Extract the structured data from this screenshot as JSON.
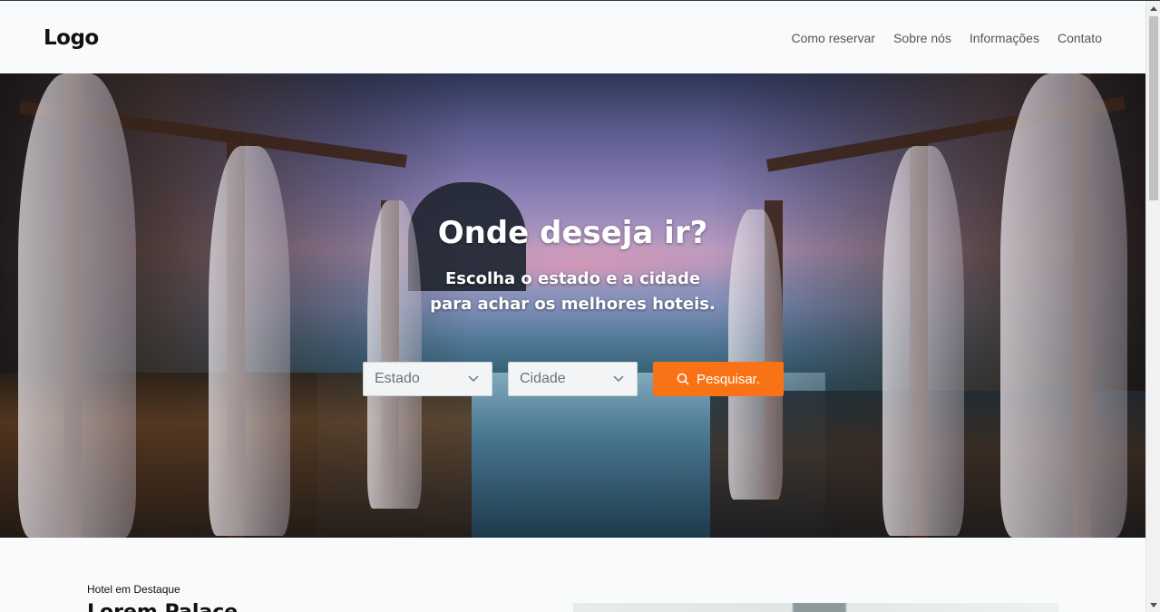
{
  "header": {
    "logo": "Logo",
    "nav": [
      "Como reservar",
      "Sobre nós",
      "Informações",
      "Contato"
    ]
  },
  "hero": {
    "title": "Onde deseja ir?",
    "subtitle_line1": "Escolha o estado e a cidade",
    "subtitle_line2": "para achar os melhores hoteis.",
    "state_select": "Estado",
    "city_select": "Cidade",
    "search_button": "Pesquisar."
  },
  "featured": {
    "label": "Hotel em Destaque",
    "title": "Lorem Palace"
  },
  "colors": {
    "accent": "#f97316",
    "background": "#f8fafc"
  },
  "icons": {
    "search": "search-icon",
    "dropdown": "chevron-down-icon"
  }
}
